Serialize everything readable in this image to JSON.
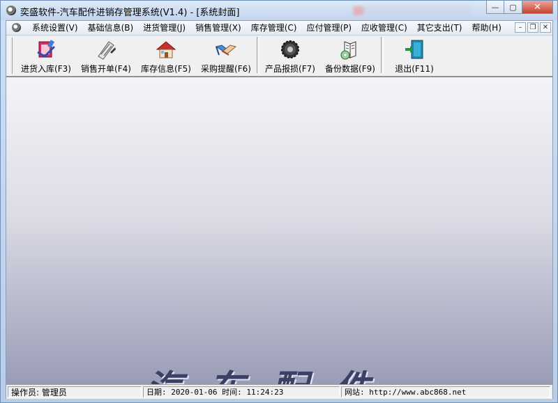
{
  "window": {
    "title": "奕盛软件-汽车配件进销存管理系统(V1.4) - [系统封面]",
    "buttons": {
      "minimize": "—",
      "maximize": "▢",
      "close": "✕"
    }
  },
  "menubar": {
    "items": [
      {
        "label": "系统设置(V)"
      },
      {
        "label": "基础信息(B)"
      },
      {
        "label": "进货管理(J)"
      },
      {
        "label": "销售管理(X)"
      },
      {
        "label": "库存管理(C)"
      },
      {
        "label": "应付管理(P)"
      },
      {
        "label": "应收管理(C)"
      },
      {
        "label": "其它支出(T)"
      },
      {
        "label": "帮助(H)"
      }
    ],
    "mdi_buttons": {
      "minimize": "–",
      "restore": "❐",
      "close": "✕"
    }
  },
  "toolbar": {
    "items": [
      {
        "label": "进货入库(F3)",
        "icon": "stock-in-icon"
      },
      {
        "label": "销售开单(F4)",
        "icon": "sales-order-icon"
      },
      {
        "label": "库存信息(F5)",
        "icon": "house-icon"
      },
      {
        "label": "采购提醒(F6)",
        "icon": "handshake-icon"
      },
      {
        "label": "产品报损(F7)",
        "icon": "gear-icon"
      },
      {
        "label": "备份数据(F9)",
        "icon": "book-disc-icon"
      },
      {
        "label": "退出(F11)",
        "icon": "exit-door-icon"
      }
    ]
  },
  "statusbar": {
    "operator": "操作员: 管理员",
    "datetime": "日期: 2020-01-06  时间: 11:24:23",
    "website": "网站: http://www.abc868.net"
  }
}
